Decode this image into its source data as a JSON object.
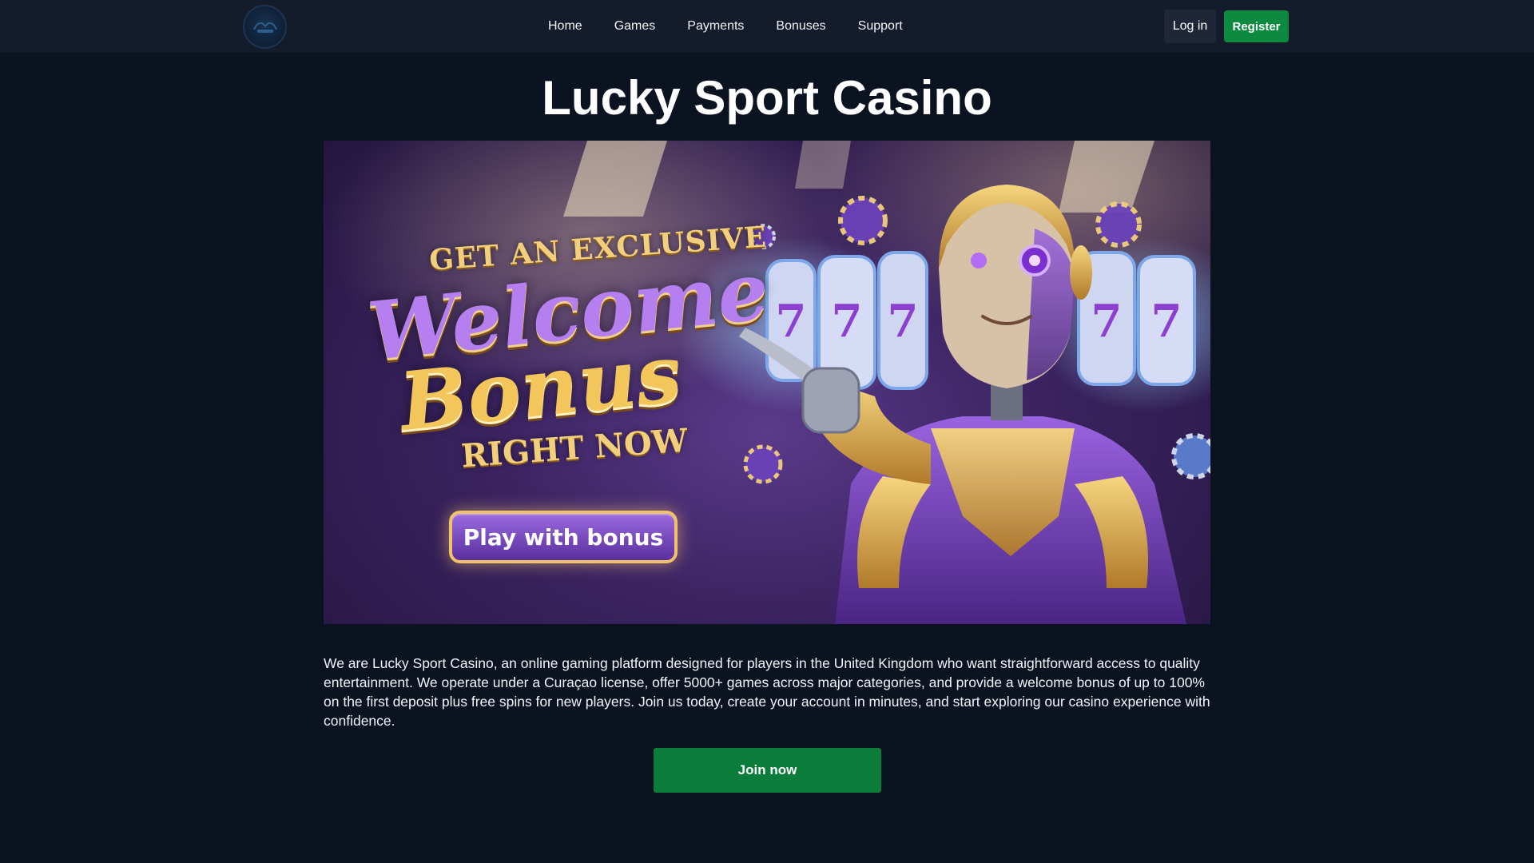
{
  "header": {
    "logo_icon": "lucky-sport-logo-icon",
    "nav": [
      "Home",
      "Games",
      "Payments",
      "Bonuses",
      "Support"
    ],
    "login_label": "Log in",
    "register_label": "Register"
  },
  "main": {
    "title": "Lucky Sport Casino",
    "banner": {
      "line1": "GET AN EXCLUSIVE",
      "line2": "Welcome",
      "line3": "Bonus",
      "line4": "RIGHT NOW",
      "cta_label": "Play with bonus",
      "illustration": "robot-pointing-slot-machines"
    },
    "intro": "We are Lucky Sport Casino, an online gaming platform designed for players in the United Kingdom who want straightforward access to quality entertainment. We operate under a Curaçao license, offer 5000+ games across major categories, and provide a welcome bonus of up to 100% on the first deposit plus free spins for new players. Join us today, create your account in minutes, and start exploring our casino experience with confidence.",
    "join_label": "Join now"
  },
  "colors": {
    "background": "#0b1220",
    "header": "#141c2c",
    "accent_green": "#0c8a3f",
    "banner_purple": "#5b3a8a",
    "banner_gold": "#f2c65b"
  }
}
